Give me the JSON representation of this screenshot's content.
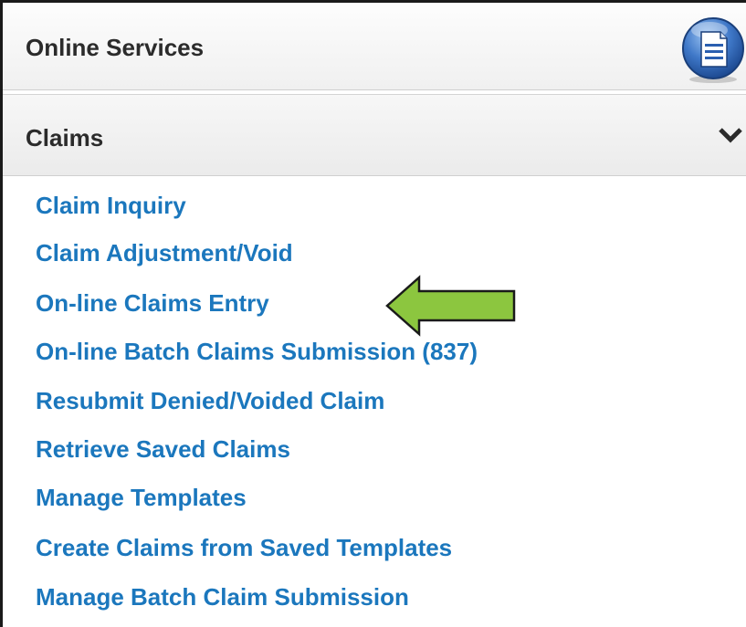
{
  "header": {
    "title": "Online Services",
    "icon": "document-icon"
  },
  "section": {
    "title": "Claims",
    "toggle_icon": "chevron-down-icon",
    "expanded": true
  },
  "links": [
    "Claim Inquiry",
    "Claim Adjustment/Void",
    "On-line Claims Entry",
    "On-line Batch Claims Submission (837)",
    "Resubmit Denied/Voided Claim",
    "Retrieve Saved Claims",
    "Manage Templates",
    "Create Claims from Saved Templates",
    "Manage Batch Claim Submission"
  ],
  "highlight": {
    "target": "On-line Claims Entry",
    "icon": "arrow-left-icon",
    "color": "#8cc63f"
  },
  "colors": {
    "link": "#1b77bd",
    "heading": "#2b2b2b",
    "icon_blue": "#2a5fb0"
  }
}
